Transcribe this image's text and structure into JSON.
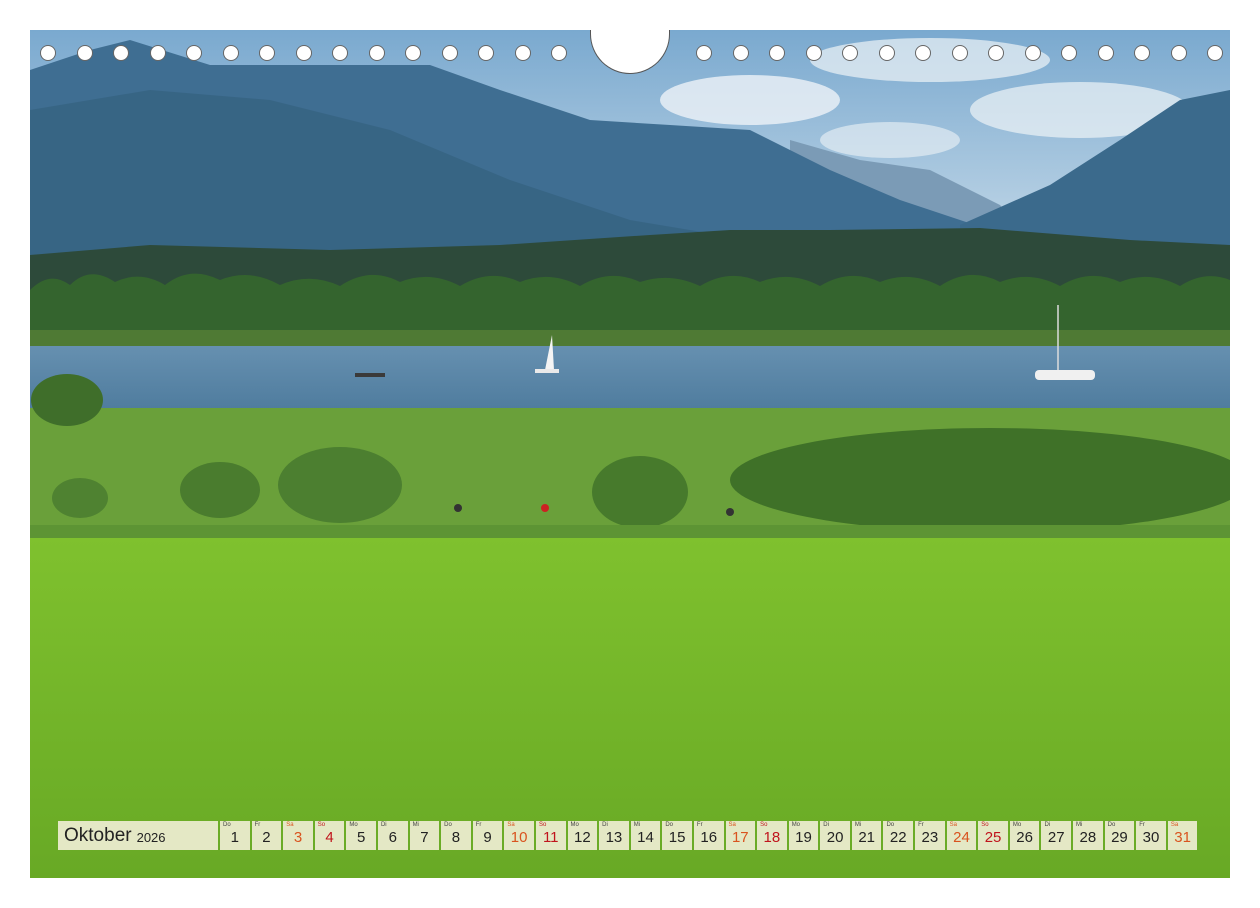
{
  "calendar": {
    "month": "Oktober",
    "year": "2026",
    "days": [
      {
        "dow": "Do",
        "num": "1",
        "type": "weekday"
      },
      {
        "dow": "Fr",
        "num": "2",
        "type": "weekday"
      },
      {
        "dow": "Sa",
        "num": "3",
        "type": "sat"
      },
      {
        "dow": "So",
        "num": "4",
        "type": "sun"
      },
      {
        "dow": "Mo",
        "num": "5",
        "type": "weekday"
      },
      {
        "dow": "Di",
        "num": "6",
        "type": "weekday"
      },
      {
        "dow": "Mi",
        "num": "7",
        "type": "weekday"
      },
      {
        "dow": "Do",
        "num": "8",
        "type": "weekday"
      },
      {
        "dow": "Fr",
        "num": "9",
        "type": "weekday"
      },
      {
        "dow": "Sa",
        "num": "10",
        "type": "sat"
      },
      {
        "dow": "So",
        "num": "11",
        "type": "sun"
      },
      {
        "dow": "Mo",
        "num": "12",
        "type": "weekday"
      },
      {
        "dow": "Di",
        "num": "13",
        "type": "weekday"
      },
      {
        "dow": "Mi",
        "num": "14",
        "type": "weekday"
      },
      {
        "dow": "Do",
        "num": "15",
        "type": "weekday"
      },
      {
        "dow": "Fr",
        "num": "16",
        "type": "weekday"
      },
      {
        "dow": "Sa",
        "num": "17",
        "type": "sat"
      },
      {
        "dow": "So",
        "num": "18",
        "type": "sun"
      },
      {
        "dow": "Mo",
        "num": "19",
        "type": "weekday"
      },
      {
        "dow": "Di",
        "num": "20",
        "type": "weekday"
      },
      {
        "dow": "Mi",
        "num": "21",
        "type": "weekday"
      },
      {
        "dow": "Do",
        "num": "22",
        "type": "weekday"
      },
      {
        "dow": "Fr",
        "num": "23",
        "type": "weekday"
      },
      {
        "dow": "Sa",
        "num": "24",
        "type": "sat"
      },
      {
        "dow": "So",
        "num": "25",
        "type": "sun"
      },
      {
        "dow": "Mo",
        "num": "26",
        "type": "weekday"
      },
      {
        "dow": "Di",
        "num": "27",
        "type": "weekday"
      },
      {
        "dow": "Mi",
        "num": "28",
        "type": "weekday"
      },
      {
        "dow": "Do",
        "num": "29",
        "type": "weekday"
      },
      {
        "dow": "Fr",
        "num": "30",
        "type": "weekday"
      },
      {
        "dow": "Sa",
        "num": "31",
        "type": "sat"
      }
    ]
  },
  "colors": {
    "sky": "#8fb8d6",
    "mountain": "#3f6f93",
    "lake": "#5a87a8",
    "meadow": "#7cbc2c",
    "saturday": "#d9531e",
    "sunday": "#c0141c"
  }
}
